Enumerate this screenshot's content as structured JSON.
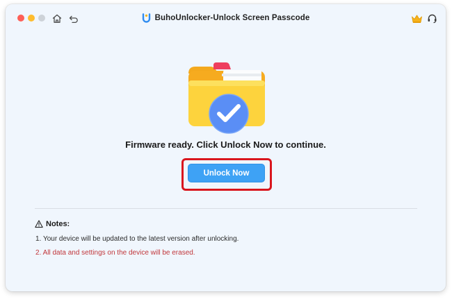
{
  "window": {
    "title": "BuhoUnlocker-Unlock Screen Passcode"
  },
  "titlebar_icons": {
    "close": "close-dot",
    "minimize": "minimize-dot",
    "maximize": "maximize-dot",
    "home": "home-icon",
    "back": "back-icon",
    "logo": "buho-logo-icon",
    "crown": "crown-icon",
    "support": "headset-icon"
  },
  "main": {
    "message": "Firmware ready. Click Unlock Now to continue.",
    "unlock_label": "Unlock Now"
  },
  "notes": {
    "title": "Notes:",
    "items": [
      "1. Your device will be updated to the latest version after unlocking.",
      "2. All data and settings on the device will be erased."
    ]
  },
  "colors": {
    "accent": "#3ea2f5",
    "highlight": "#d9161e",
    "warning_text": "#c1363a",
    "background": "#f0f6fd"
  }
}
